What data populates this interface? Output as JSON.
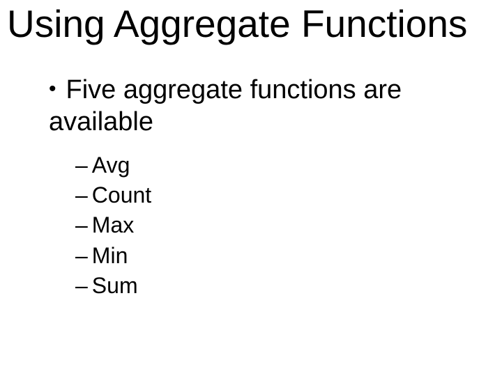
{
  "title": "Using Aggregate Functions",
  "bullet": {
    "line1": "Five aggregate functions are",
    "line2": "available"
  },
  "sub": {
    "items": [
      "Avg",
      "Count",
      "Max",
      "Min",
      "Sum"
    ]
  }
}
